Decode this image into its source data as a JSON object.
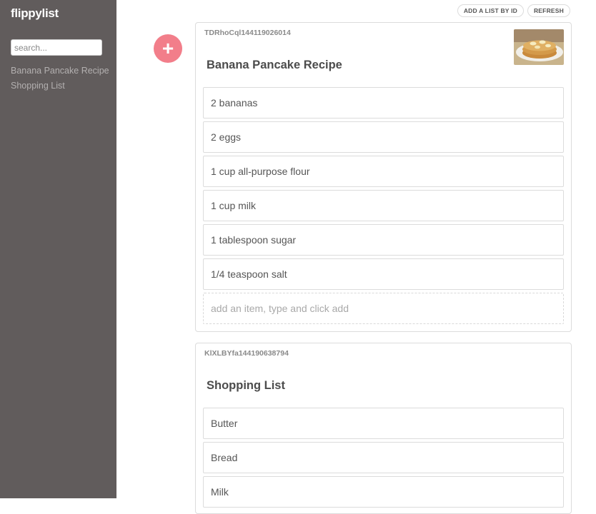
{
  "app": {
    "title": "flippylist"
  },
  "sidebar": {
    "search_placeholder": "search...",
    "lists": [
      {
        "label": "Banana Pancake Recipe"
      },
      {
        "label": "Shopping List"
      }
    ]
  },
  "toolbar": {
    "add_by_id_label": "ADD A LIST BY ID",
    "refresh_label": "REFRESH"
  },
  "fab": {
    "icon": "plus-icon",
    "glyph": "+"
  },
  "lists": [
    {
      "id": "TDRhoCql144119026014",
      "title": "Banana Pancake Recipe",
      "items": [
        "2 bananas",
        "2 eggs",
        "1 cup all-purpose flour",
        "1 cup milk",
        "1 tablespoon sugar",
        "1/4 teaspoon salt"
      ],
      "add_placeholder": "add an item, type and click add"
    },
    {
      "id": "KlXLBYfa144190638794",
      "title": "Shopping List",
      "items": [
        "Butter",
        "Bread",
        "Milk"
      ]
    }
  ],
  "colors": {
    "sidebar_bg": "#615c5c",
    "accent": "#f27e8a"
  }
}
